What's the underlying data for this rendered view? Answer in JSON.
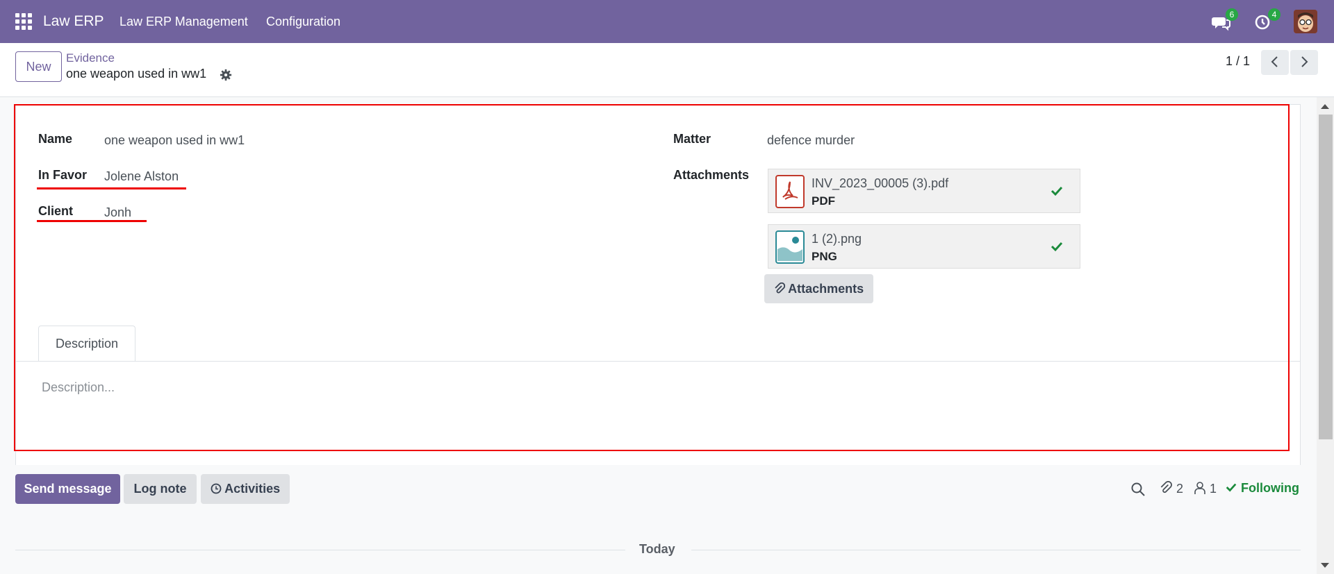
{
  "navbar": {
    "brand": "Law ERP",
    "menu": [
      "Law ERP Management",
      "Configuration"
    ],
    "messages_count": "6",
    "activities_count": "4"
  },
  "control_panel": {
    "new_label": "New",
    "breadcrumb": "Evidence",
    "record_title": "one weapon used in ww1",
    "pager": "1 / 1"
  },
  "form": {
    "name_label": "Name",
    "name_value": "one weapon used in ww1",
    "in_favor_label": "In Favor",
    "in_favor_value": "Jolene Alston",
    "client_label": "Client",
    "client_value": "Jonh",
    "matter_label": "Matter",
    "matter_value": "defence murder",
    "attachments_label": "Attachments",
    "attachments": [
      {
        "name": "INV_2023_00005 (3).pdf",
        "type": "PDF"
      },
      {
        "name": "1 (2).png",
        "type": "PNG"
      }
    ],
    "attachments_button": "Attachments",
    "tab_description": "Description",
    "description_placeholder": "Description..."
  },
  "chatter": {
    "send_message": "Send message",
    "log_note": "Log note",
    "activities": "Activities",
    "attachments_count": "2",
    "followers_count": "1",
    "following": "Following",
    "today": "Today"
  },
  "colors": {
    "primary": "#71639e",
    "highlight": "#e00000",
    "success": "#1a8a3b"
  }
}
